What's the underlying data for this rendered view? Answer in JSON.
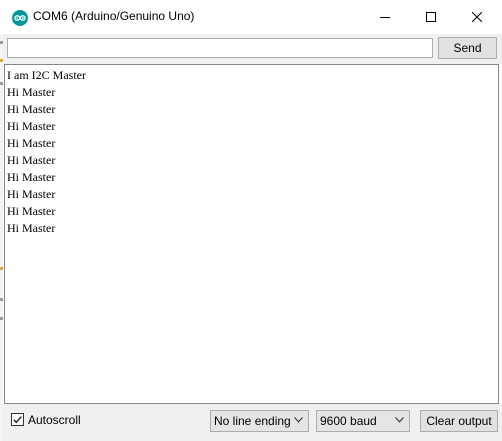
{
  "window": {
    "title": "COM6 (Arduino/Genuino Uno)",
    "accent_color": "#00979c"
  },
  "toolbar": {
    "input_value": "",
    "send_label": "Send"
  },
  "output": {
    "lines": [
      "I am I2C Master",
      "Hi Master",
      "Hi Master",
      "Hi Master",
      "Hi Master",
      "Hi Master",
      "Hi Master",
      "Hi Master",
      "Hi Master",
      "Hi Master"
    ]
  },
  "footer": {
    "autoscroll_label": "Autoscroll",
    "autoscroll_checked": true,
    "line_ending": "No line ending",
    "baud": "9600 baud",
    "clear_label": "Clear output"
  }
}
